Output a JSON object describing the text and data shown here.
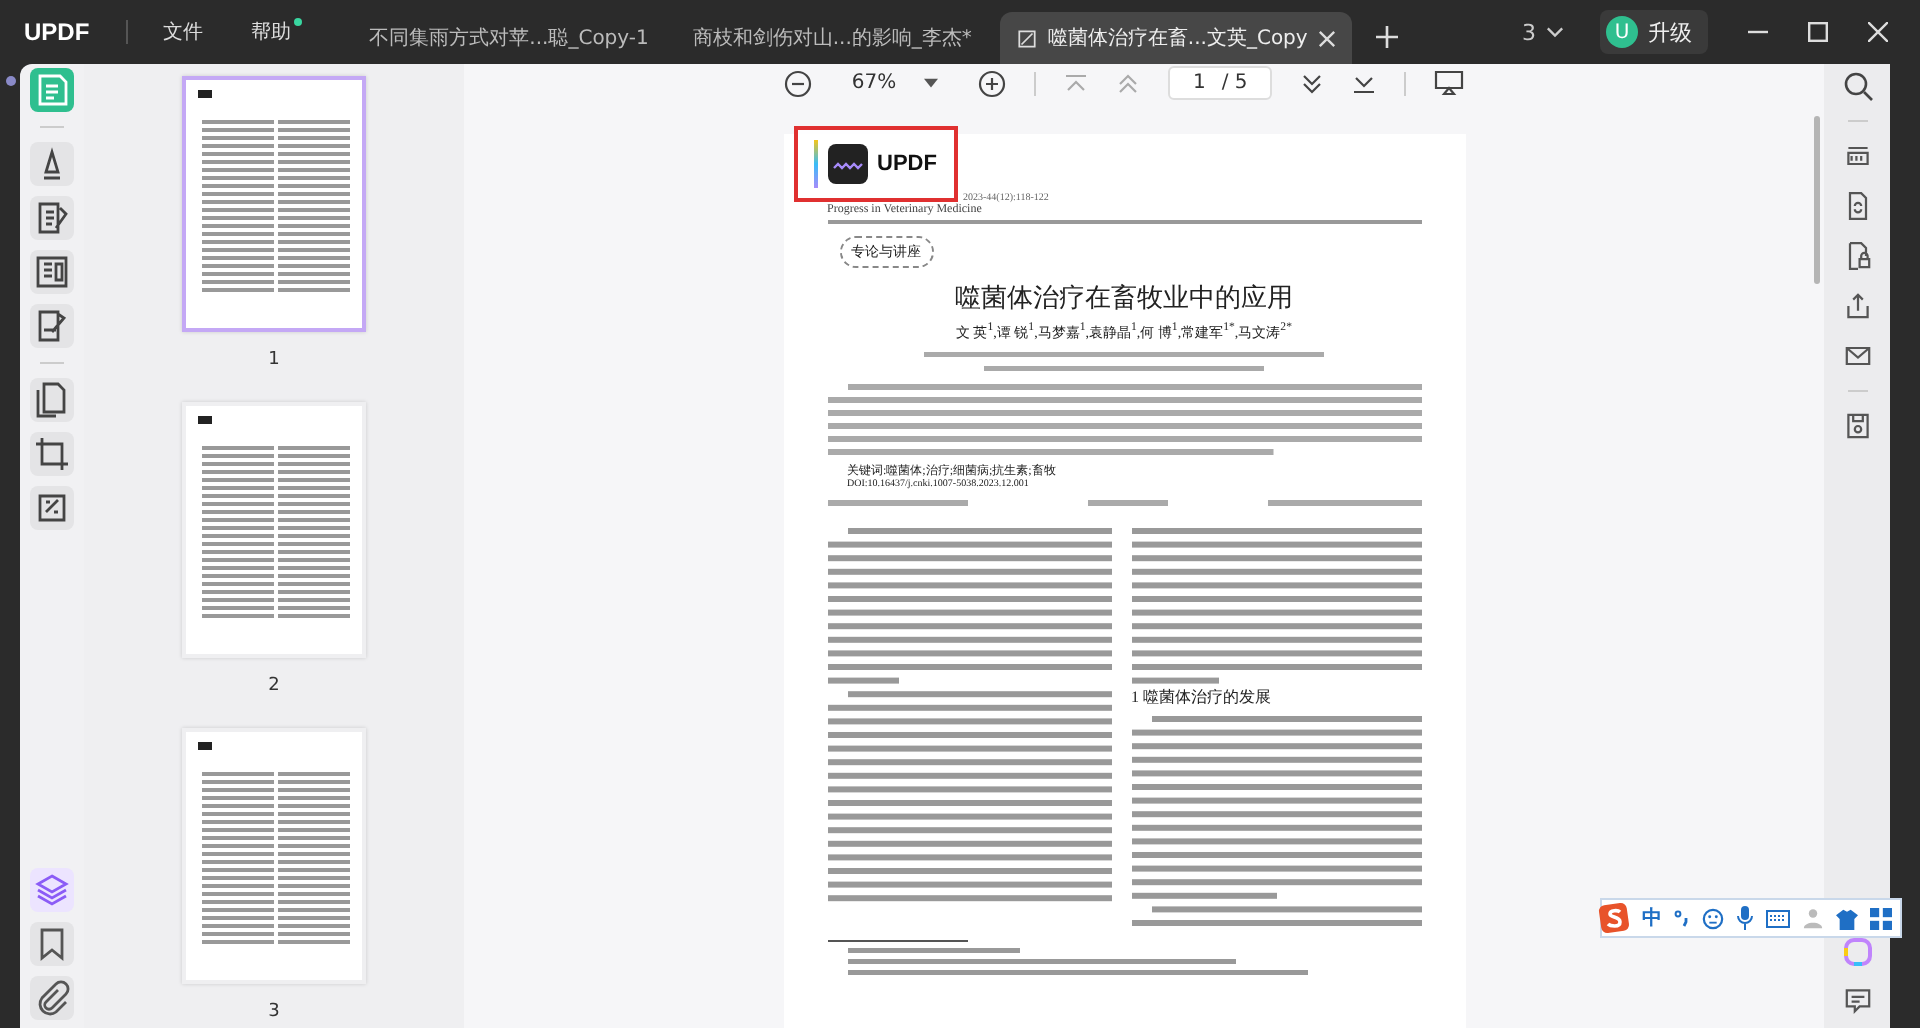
{
  "app": {
    "logo": "UPDF"
  },
  "menus": [
    {
      "label": "文件",
      "badge": false
    },
    {
      "label": "帮助",
      "badge": true
    }
  ],
  "tabs": [
    {
      "label": "不同集雨方式对苹...聪_Copy-1",
      "selected": false
    },
    {
      "label": "商枝和剑伤对山...的影响_李杰*",
      "selected": false
    },
    {
      "label": "噬菌体治疗在畜...文英_Copy",
      "selected": true
    }
  ],
  "window_count": "3",
  "account": {
    "avatar": "U",
    "label": "升级"
  },
  "left_tools": [
    {
      "selected": true
    },
    {
      "selected": false
    },
    {
      "selected": false
    },
    {
      "selected": false
    },
    {
      "selected": false
    },
    {
      "selected": false
    },
    {
      "selected": false
    },
    {
      "selected": false
    }
  ],
  "bottom_tools": [
    {
      "selected": true
    },
    {
      "selected": false
    },
    {
      "selected": false
    }
  ],
  "thumbnails": [
    {
      "label": "1",
      "selected": true
    },
    {
      "label": "2",
      "selected": false
    },
    {
      "label": "3",
      "selected": false
    }
  ],
  "toolbar": {
    "zoom": "67%",
    "page": "1",
    "total": "/ 5"
  },
  "document": {
    "watermark": "UPDF",
    "citation": "2023-44(12):118-122",
    "journal": "Progress in Veterinary Medicine",
    "column_tag": "专论与讲座",
    "title": "噬菌体治疗在畜牧业中的应用",
    "authors": "文 英$^{1}$,谭 锐$^{1}$,马梦嘉$^{1}$,袁静晶$^{1}$,何 博$^{1}$,常建军$^{1*}$,马文涛$^{2*}$",
    "keywords": "关键词:噬菌体;治疗;细菌病;抗生素;畜牧",
    "doi": "DOI:10.16437/j.cnki.1007-5038.2023.12.001",
    "section_heading": "1  噬菌体治疗的发展"
  },
  "ime": {
    "mode": "中"
  }
}
